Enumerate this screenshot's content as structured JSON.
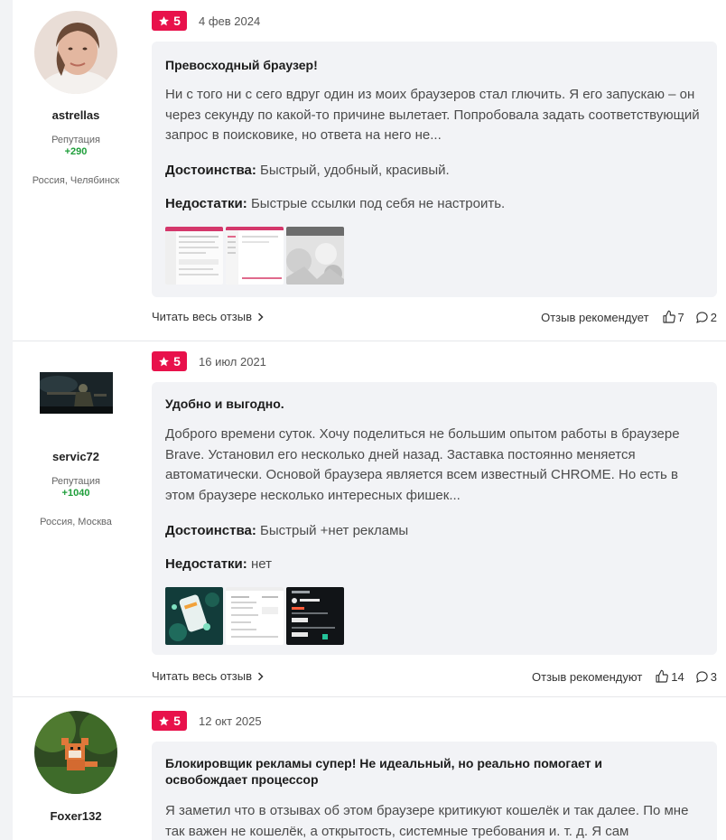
{
  "reviews": [
    {
      "author": {
        "name": "astrellas",
        "reputation_label": "Репутация",
        "reputation": "+290",
        "location": "Россия, Челябинск"
      },
      "rating": "5",
      "date": "4 фев 2024",
      "title": "Превосходный браузер!",
      "text": "Ни с того ни с сего вдруг один из моих браузеров стал глючить. Я его запускаю – он через секунду по какой-то причине вылетает. Попробовала задать соответствующий запрос в поисковике, но ответа на него не...",
      "pros_label": "Достоинства:",
      "pros": "Быстрый, удобный, красивый.",
      "cons_label": "Недостатки:",
      "cons": "Быстрые ссылки под себя не настроить.",
      "read_more": "Читать весь отзыв",
      "recommend": "Отзыв рекомендует",
      "likes": "7",
      "comments": "2"
    },
    {
      "author": {
        "name": "servic72",
        "reputation_label": "Репутация",
        "reputation": "+1040",
        "location": "Россия, Москва"
      },
      "rating": "5",
      "date": "16 июл 2021",
      "title": "Удобно и выгодно.",
      "text": "Доброго времени суток. Хочу поделиться не большим опытом работы в браузере Brave. Установил его несколько дней назад. Заставка постоянно меняется автоматически. Основой браузера является всем известный CHROME. Но есть в этом браузере несколько интересных фишек...",
      "pros_label": "Достоинства:",
      "pros": "Быстрый +нет рекламы",
      "cons_label": "Недостатки:",
      "cons": "нет",
      "read_more": "Читать весь отзыв",
      "recommend": "Отзыв рекомендуют",
      "likes": "14",
      "comments": "3"
    },
    {
      "author": {
        "name": "Foxer132"
      },
      "rating": "5",
      "date": "12 окт 2025",
      "title": "Блокировщик рекламы супер! Не идеальный, но реально помогает и освобождает процессор",
      "text": "Я заметил что в отзывах об этом браузере критикуют кошелёк и так далее. По мне так важен не кошелёк, а открытость, системные требования и. т. д. Я сам"
    }
  ],
  "colors": {
    "badge": "#e8114b",
    "reputation": "#1e9e3a",
    "card_bg": "#f2f3f6",
    "page_bg": "#f2f3f5"
  },
  "icons": {
    "rating": "star-icon",
    "read_more": "chevron-right-icon",
    "like": "thumb-up-icon",
    "comment": "comment-icon"
  }
}
